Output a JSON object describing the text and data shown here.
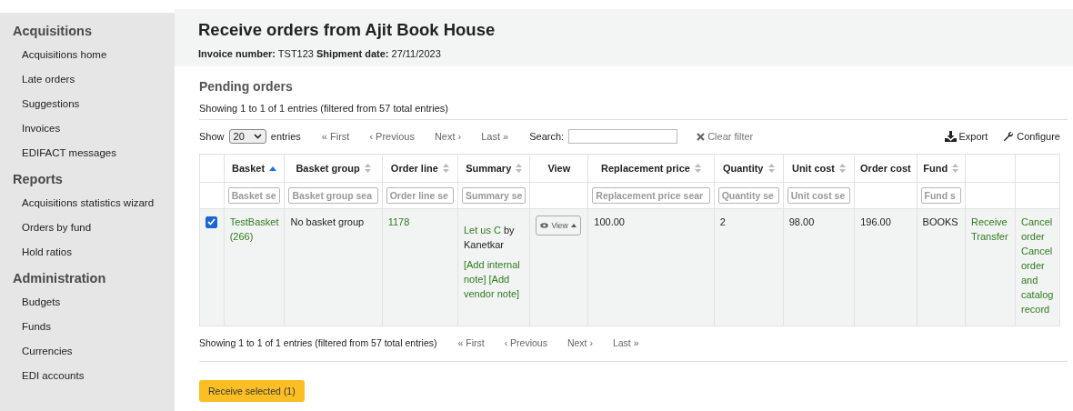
{
  "sidebar": [
    {
      "heading": "Acquisitions",
      "items": [
        "Acquisitions home",
        "Late orders",
        "Suggestions",
        "Invoices",
        "EDIFACT messages"
      ]
    },
    {
      "heading": "Reports",
      "items": [
        "Acquisitions statistics wizard",
        "Orders by fund",
        "Hold ratios"
      ]
    },
    {
      "heading": "Administration",
      "items": [
        "Budgets",
        "Funds",
        "Currencies",
        "EDI accounts"
      ]
    }
  ],
  "page": {
    "title": "Receive orders from Ajit Book House",
    "invoice_label": "Invoice number:",
    "invoice_number": "TST123",
    "shipment_label": "Shipment date:",
    "shipment_date": "27/11/2023"
  },
  "pending": {
    "heading": "Pending orders",
    "info_top": "Showing 1 to 1 of 1 entries (filtered from 57 total entries)",
    "show_label": "Show",
    "page_size": "20",
    "entries_label": "entries",
    "pager": [
      "« First",
      "‹ Previous",
      "Next ›",
      "Last »"
    ],
    "search_label": "Search:",
    "clear_filter": "Clear filter",
    "export": "Export",
    "configure": "Configure",
    "columns": [
      {},
      {
        "label": "Basket",
        "sorted": true,
        "placeholder": "Basket se"
      },
      {
        "label": "Basket group",
        "sorted": false,
        "placeholder": "Basket group sea"
      },
      {
        "label": "Order line",
        "sorted": false,
        "placeholder": "Order line se"
      },
      {
        "label": "Summary",
        "sorted": false,
        "placeholder": "Summary se"
      },
      {
        "label": "View"
      },
      {
        "label": "Replacement price",
        "sorted": false,
        "placeholder": "Replacement price sear"
      },
      {
        "label": "Quantity",
        "sorted": false,
        "placeholder": "Quantity se"
      },
      {
        "label": "Unit cost",
        "sorted": false,
        "placeholder": "Unit cost se"
      },
      {
        "label": "Order cost"
      },
      {
        "label": "Fund",
        "sorted": false,
        "placeholder": "Fund s"
      },
      {},
      {}
    ],
    "rows": [
      {
        "checked": true,
        "basket": "TestBasket (266)",
        "basket_group": "No basket group",
        "order_line": "1178",
        "title": "Let us C",
        "author": " by Kanetkar",
        "notes": "[Add internal note] [Add vendor note]",
        "view": "View",
        "replacement_price": "100.00",
        "quantity": "2",
        "unit_cost": "98.00",
        "order_cost": "196.00",
        "fund": "BOOKS",
        "actions": [
          "Receive",
          "Transfer"
        ],
        "cancel": [
          "Cancel order",
          "Cancel order and catalog record"
        ]
      }
    ],
    "info_bottom": "Showing 1 to 1 of 1 entries (filtered from 57 total entries)",
    "pager_bottom": [
      "« First",
      "‹ Previous",
      "Next ›",
      "Last »"
    ],
    "receive_button": "Receive selected (1)"
  }
}
